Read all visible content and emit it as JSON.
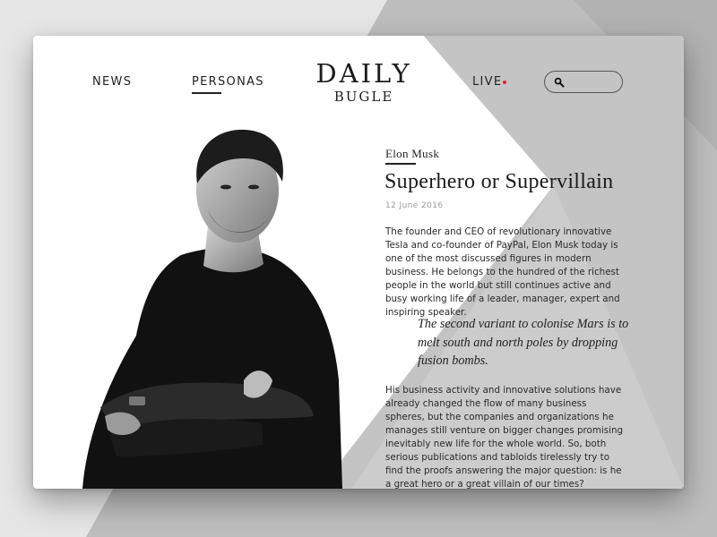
{
  "nav": {
    "news": "NEWS",
    "personas": "PERSONAS",
    "live": "LIVE"
  },
  "logo": {
    "main": "DAILY",
    "sub": "BUGLE"
  },
  "search": {
    "icon": "search-icon",
    "value": "",
    "placeholder": ""
  },
  "colors": {
    "live_dot": "#e0262b",
    "text": "#1a1a1a",
    "background_grey": "#c4c4c4"
  },
  "article": {
    "persona": "Elon Musk",
    "title": "Superhero or Supervillain",
    "date": "12 June 2016",
    "paragraph_1": "The founder and CEO of revolutionary innovative Tesla and co-founder of PayPal, Elon Musk today is one of the most discussed figures in modern business. He belongs to the hundred of the richest people in the world but still continues active and busy working life of a leader, manager, expert and inspiring speaker.",
    "quote": "The second variant to colonise Mars is to melt south and north poles by dropping fusion bombs.",
    "paragraph_2": "His business activity and innovative solutions have already changed the flow of many business spheres, but the companies and organizations he manages still venture on bigger changes promising inevitably new life for the whole world. So, both serious publications and tabloids tirelessly try to find the proofs answering the major question: is he a great hero or a great villain of our times?"
  }
}
